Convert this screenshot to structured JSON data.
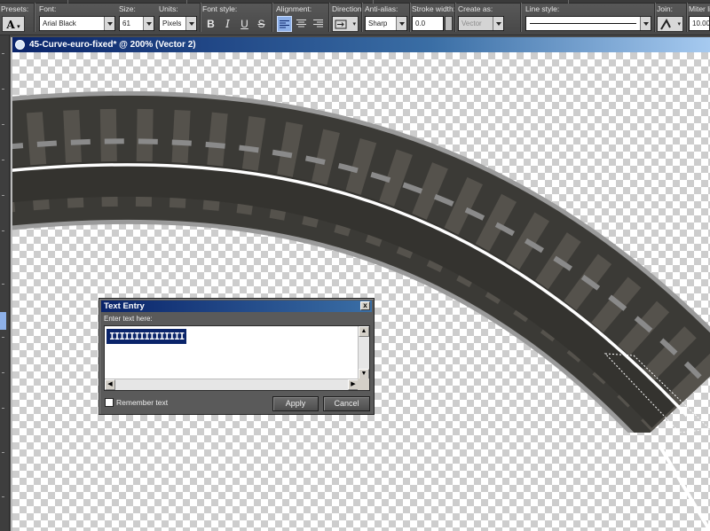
{
  "toolbar": {
    "presets_label": "Presets:",
    "font_label": "Font:",
    "font_value": "Arial Black",
    "size_label": "Size:",
    "size_value": "61",
    "units_label": "Units:",
    "units_value": "Pixels",
    "font_style_label": "Font style:",
    "bold_glyph": "B",
    "italic_glyph": "I",
    "underline_glyph": "U",
    "strike_glyph": "S",
    "alignment_label": "Alignment:",
    "direction_label": "Direction:",
    "antialias_label": "Anti-alias:",
    "antialias_value": "Sharp",
    "stroke_label": "Stroke width:",
    "stroke_value": "0.0",
    "create_as_label": "Create as:",
    "create_as_value": "Vector",
    "line_style_label": "Line style:",
    "join_label": "Join:",
    "miter_label": "Miter li",
    "miter_value": "10.00"
  },
  "document": {
    "title": "45-Curve-euro-fixed* @ 200% (Vector 2)"
  },
  "dialog": {
    "title": "Text Entry",
    "close_glyph": "x",
    "prompt": "Enter text here:",
    "text_value": "IIIIIIIIIIIIIII",
    "remember_label": "Remember text",
    "apply_label": "Apply",
    "cancel_label": "Cancel"
  },
  "colors": {
    "accent": "#0a246a",
    "road": "#3b3a36",
    "road_marking": "#8a8a8a",
    "edge_line": "#ffffff",
    "selected_button": "#8db0e8"
  },
  "icons": {
    "presets": "text-tool-icon",
    "direction": "text-direction-icon",
    "join": "line-join-icon"
  }
}
